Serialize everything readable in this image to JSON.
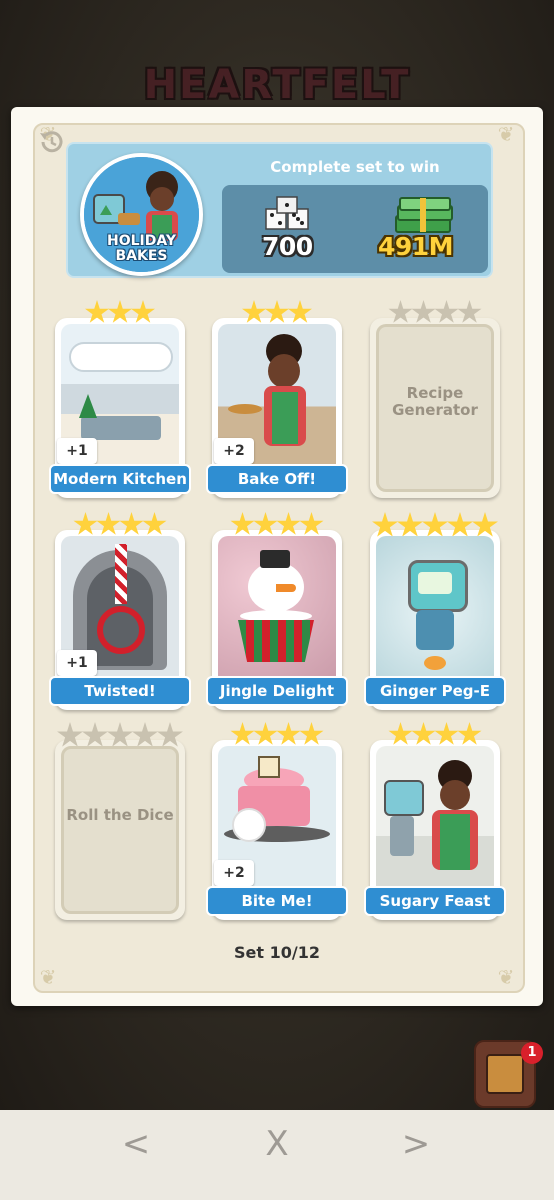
{
  "event": {
    "title": "HEARTFELT"
  },
  "set": {
    "name": "HOLIDAY BAKES",
    "reward_caption": "Complete set to win",
    "rewards": {
      "dice": "700",
      "cash": "491M"
    },
    "counter": "Set 10/12"
  },
  "cards": [
    {
      "name": "Modern Kitchen",
      "stars": 3,
      "collected": true,
      "dup": "+1"
    },
    {
      "name": "Bake Off!",
      "stars": 3,
      "collected": true,
      "dup": "+2"
    },
    {
      "name": "Recipe Generator",
      "stars": 4,
      "collected": false,
      "dup": ""
    },
    {
      "name": "Twisted!",
      "stars": 4,
      "collected": true,
      "dup": "+1"
    },
    {
      "name": "Jingle Delight",
      "stars": 4,
      "collected": true,
      "dup": ""
    },
    {
      "name": "Ginger Peg-E",
      "stars": 5,
      "collected": true,
      "dup": ""
    },
    {
      "name": "Roll the Dice",
      "stars": 5,
      "collected": false,
      "dup": ""
    },
    {
      "name": "Bite Me!",
      "stars": 4,
      "collected": true,
      "dup": "+2"
    },
    {
      "name": "Sugary Feast",
      "stars": 4,
      "collected": true,
      "dup": ""
    }
  ],
  "notifications": {
    "count": "1"
  },
  "nav": {
    "back": "<",
    "close": "X",
    "forward": ">"
  },
  "colors": {
    "ribbon": "#2f8ed2",
    "star": "#ffd23c",
    "header": "#9fd0e4"
  }
}
